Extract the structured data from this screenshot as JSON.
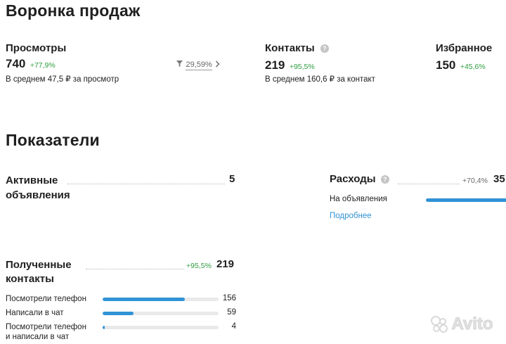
{
  "funnel": {
    "title": "Воронка продаж",
    "views": {
      "label": "Просмотры",
      "value": "740",
      "delta": "+77,9%",
      "conversion": "29,59%",
      "note": "В среднем 47,5 ₽ за просмотр"
    },
    "contacts": {
      "label": "Контакты",
      "value": "219",
      "delta": "+95,5%",
      "note": "В среднем 160,6 ₽ за контакт"
    },
    "favorites": {
      "label": "Избранное",
      "value": "150",
      "delta": "+45,6%"
    }
  },
  "metrics": {
    "title": "Показатели",
    "active_ads": {
      "label_line1": "Активные",
      "label_line2": "объявления",
      "value": "5"
    },
    "expenses": {
      "label": "Расходы",
      "delta": "+70,4%",
      "value": "35",
      "row_label": "На объявления",
      "row_fill": 1.0,
      "link": "Подробнее"
    },
    "received_contacts": {
      "label_line1": "Полученные",
      "label_line2": "контакты",
      "delta": "+95,5%",
      "value": "219",
      "rows": [
        {
          "label_line1": "Посмотрели телефон",
          "label_line2": "",
          "value": "156",
          "fill": 0.712
        },
        {
          "label_line1": "Написали в чат",
          "label_line2": "",
          "value": "59",
          "fill": 0.269
        },
        {
          "label_line1": "Посмотрели телефон",
          "label_line2": "и написали в чат",
          "value": "4",
          "fill": 0.018
        }
      ]
    }
  },
  "watermark": "Avito",
  "colors": {
    "accent": "#2f93d6",
    "positive": "#2e9e3f"
  }
}
